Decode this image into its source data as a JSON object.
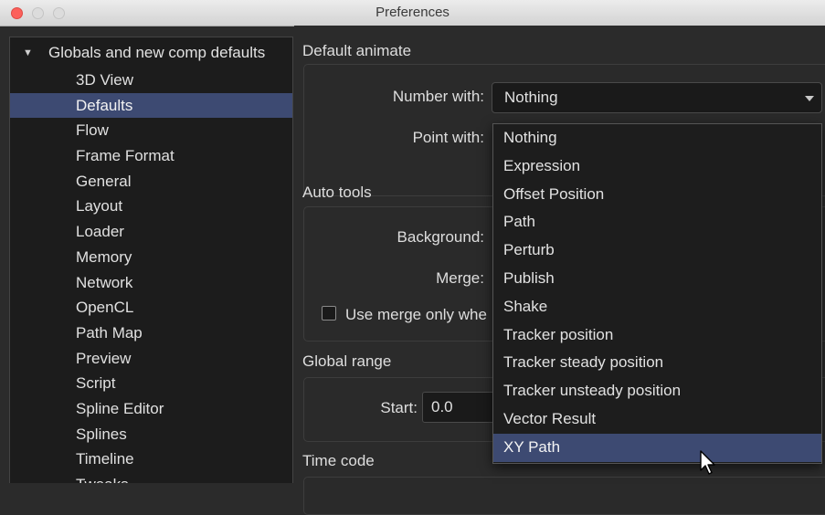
{
  "window": {
    "title": "Preferences"
  },
  "sidebar": {
    "root": {
      "label": "Globals and new comp defaults",
      "expanded": true
    },
    "items": [
      {
        "label": "3D View"
      },
      {
        "label": "Defaults",
        "selected": true
      },
      {
        "label": "Flow"
      },
      {
        "label": "Frame Format"
      },
      {
        "label": "General"
      },
      {
        "label": "Layout"
      },
      {
        "label": "Loader"
      },
      {
        "label": "Memory"
      },
      {
        "label": "Network"
      },
      {
        "label": "OpenCL"
      },
      {
        "label": "Path Map"
      },
      {
        "label": "Preview"
      },
      {
        "label": "Script"
      },
      {
        "label": "Spline Editor"
      },
      {
        "label": "Splines"
      },
      {
        "label": "Timeline"
      },
      {
        "label": "Tweaks"
      }
    ]
  },
  "default_animate": {
    "title": "Default animate",
    "number_with_label": "Number with:",
    "number_with_value": "Nothing",
    "point_with_label": "Point with:"
  },
  "auto_tools": {
    "title": "Auto tools",
    "background_label": "Background:",
    "merge_label": "Merge:",
    "use_merge_label": "Use merge only whe"
  },
  "global_range": {
    "title": "Global range",
    "start_label": "Start:",
    "start_value": "0.0"
  },
  "time_code": {
    "title": "Time code"
  },
  "dropdown": {
    "options": [
      {
        "label": "Nothing"
      },
      {
        "label": "Expression"
      },
      {
        "label": "Offset Position"
      },
      {
        "label": "Path"
      },
      {
        "label": "Perturb"
      },
      {
        "label": "Publish"
      },
      {
        "label": "Shake"
      },
      {
        "label": "Tracker position"
      },
      {
        "label": "Tracker steady position"
      },
      {
        "label": "Tracker unsteady position"
      },
      {
        "label": "Vector Result"
      },
      {
        "label": "XY Path",
        "hovered": true
      }
    ]
  },
  "colors": {
    "selection": "#3d4a72",
    "close_button": "#fc605b",
    "background": "#2b2b2b",
    "sidebar_bg": "#1c1c1c"
  },
  "icons": [
    "close-icon",
    "minimize-icon",
    "maximize-icon",
    "disclosure-triangle-icon",
    "dropdown-arrow-icon",
    "mouse-cursor-icon"
  ]
}
